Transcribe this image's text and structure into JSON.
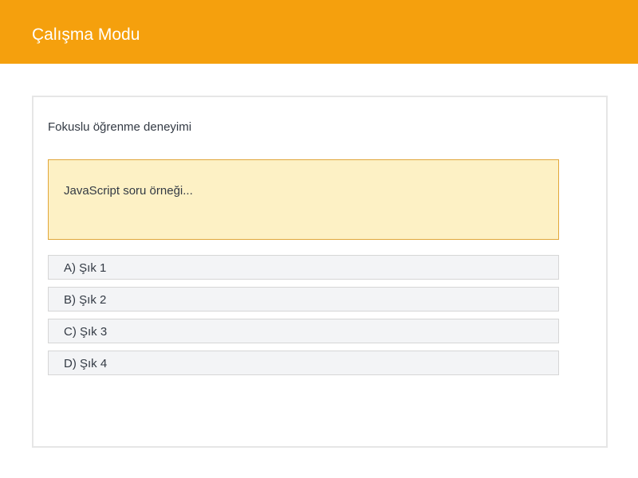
{
  "header": {
    "title": "Çalışma Modu"
  },
  "card": {
    "subtitle": "Fokuslu öğrenme deneyimi",
    "question": "JavaScript soru örneği...",
    "options": [
      {
        "label": "A) Şık 1"
      },
      {
        "label": "B) Şık 2"
      },
      {
        "label": "C) Şık 3"
      },
      {
        "label": "D) Şık 4"
      }
    ]
  },
  "colors": {
    "header_bg": "#f5a00d",
    "question_bg": "#fdf1c5",
    "question_border": "#e1a73a",
    "option_bg": "#f3f4f6"
  }
}
